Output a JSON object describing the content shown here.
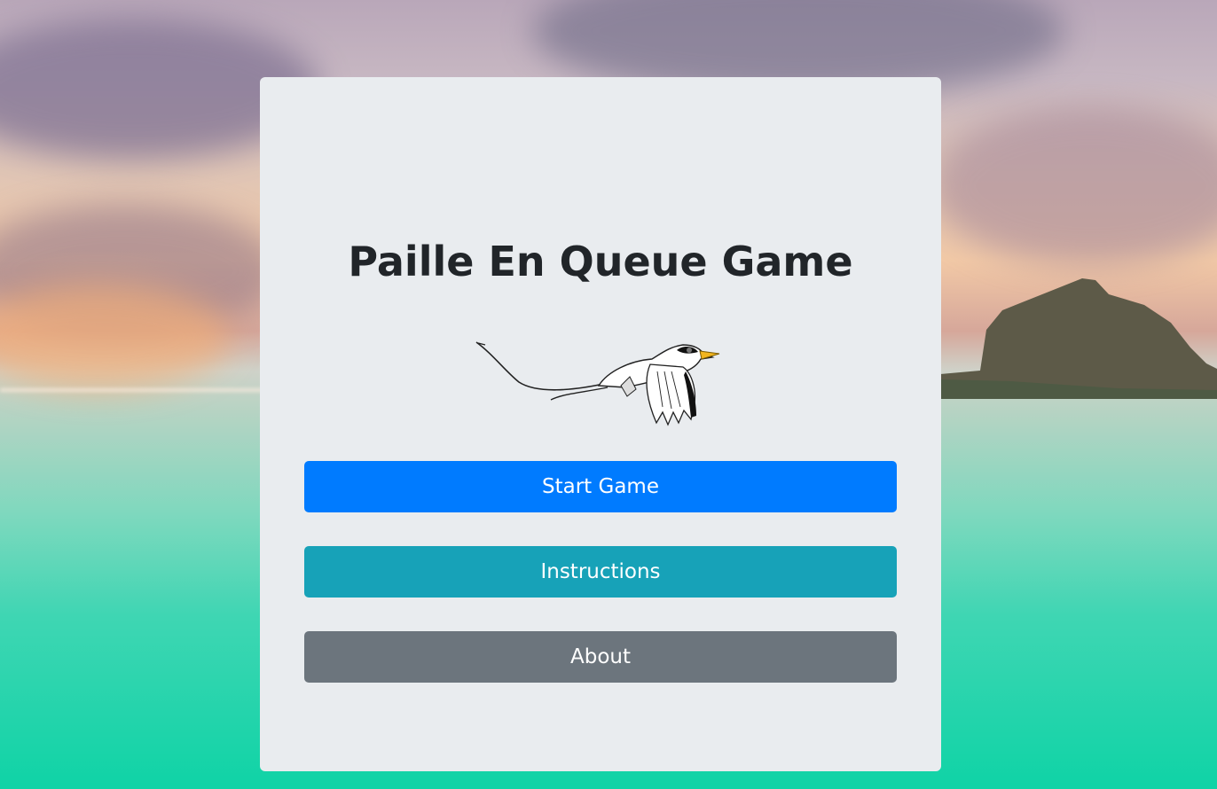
{
  "page": {
    "title": "Paille En Queue Game"
  },
  "logo": {
    "icon": "tropicbird-icon"
  },
  "buttons": {
    "start_label": "Start Game",
    "instructions_label": "Instructions",
    "about_label": "About"
  },
  "colors": {
    "start": "#007bff",
    "instructions": "#17a2b8",
    "about": "#6c757d",
    "panel": "#e9ecef",
    "title_text": "#212529"
  }
}
